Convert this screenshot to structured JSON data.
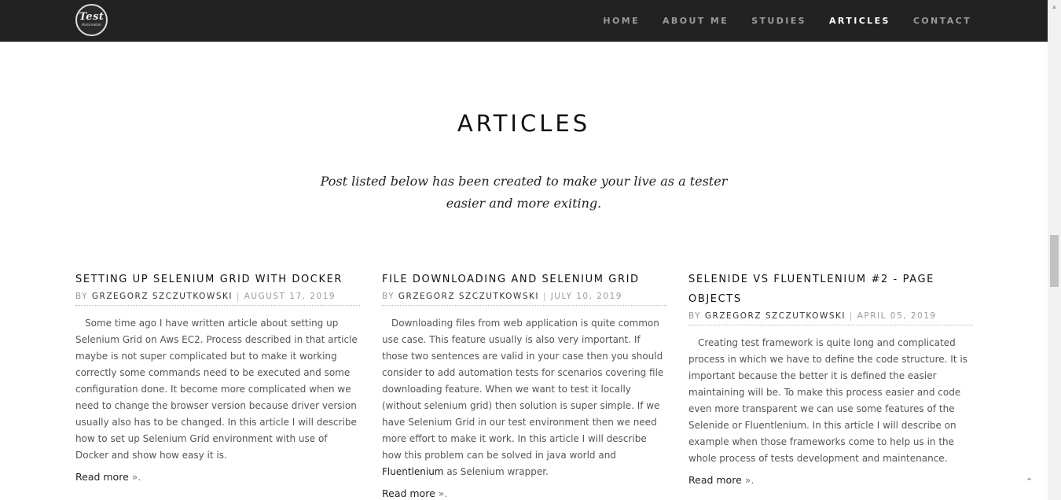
{
  "logo": {
    "main": "Test",
    "sub": "Automation"
  },
  "nav": {
    "items": [
      {
        "label": "HOME"
      },
      {
        "label": "ABOUT ME"
      },
      {
        "label": "STUDIES"
      },
      {
        "label": "ARTICLES",
        "active": true
      },
      {
        "label": "CONTACT"
      }
    ]
  },
  "page": {
    "title": "ARTICLES",
    "intro": "Post listed below has been created to make your live as a tester easier and more exiting."
  },
  "articles": [
    {
      "title": "SETTING UP SELENIUM GRID WITH DOCKER",
      "by": "BY",
      "author": "GRZEGORZ SZCZUTKOWSKI",
      "separator": "|",
      "date": "AUGUST 17, 2019",
      "excerpt": "Some time ago I have written article about setting up Selenium Grid on Aws EC2. Process described in that article maybe is not super complicated but to make it working correctly some commands need to be executed and some configuration done. It become more complicated when we need to change the browser version because driver version usually also has to be changed. In this article I will describe how to set up Selenium Grid environment with use of Docker and show how easy it is.",
      "read_more": "Read more",
      "raquo": "»."
    },
    {
      "title": "FILE DOWNLOADING AND SELENIUM GRID",
      "by": "BY",
      "author": "GRZEGORZ SZCZUTKOWSKI",
      "separator": "|",
      "date": "JULY 10, 2019",
      "excerpt_pre": "Downloading files from web application is quite common use case. This feature usually is also very important. If those two sentences are valid in your case then you should consider to add automation tests for scenarios covering file downloading feature. When we want to test it locally (without selenium grid) then solution is super simple. If we have Selenium Grid in our test environment then we need more effort to make it work. In this article I will describe how this problem can be solved in java world and ",
      "excerpt_link": "Fluentlenium",
      "excerpt_post": " as Selenium wrapper.",
      "read_more": "Read more",
      "raquo": "»."
    },
    {
      "title": "SELENIDE VS FLUENTLENIUM #2 - PAGE OBJECTS",
      "by": "BY",
      "author": "GRZEGORZ SZCZUTKOWSKI",
      "separator": "|",
      "date": "APRIL 05, 2019",
      "excerpt": "Creating test framework is quite long and complicated process in which we have to define the code structure. It is important because the better it is defined the easier maintaining will be. To make this process easier and code even more transparent we can use some features of the Selenide or Fluentlenium. In this article I will describe on example when those frameworks come to help us in the whole process of tests development and maintenance.",
      "read_more": "Read more",
      "raquo": "»."
    }
  ],
  "icons": {
    "scroll_up": "▲",
    "back_to_top": "⌃"
  }
}
